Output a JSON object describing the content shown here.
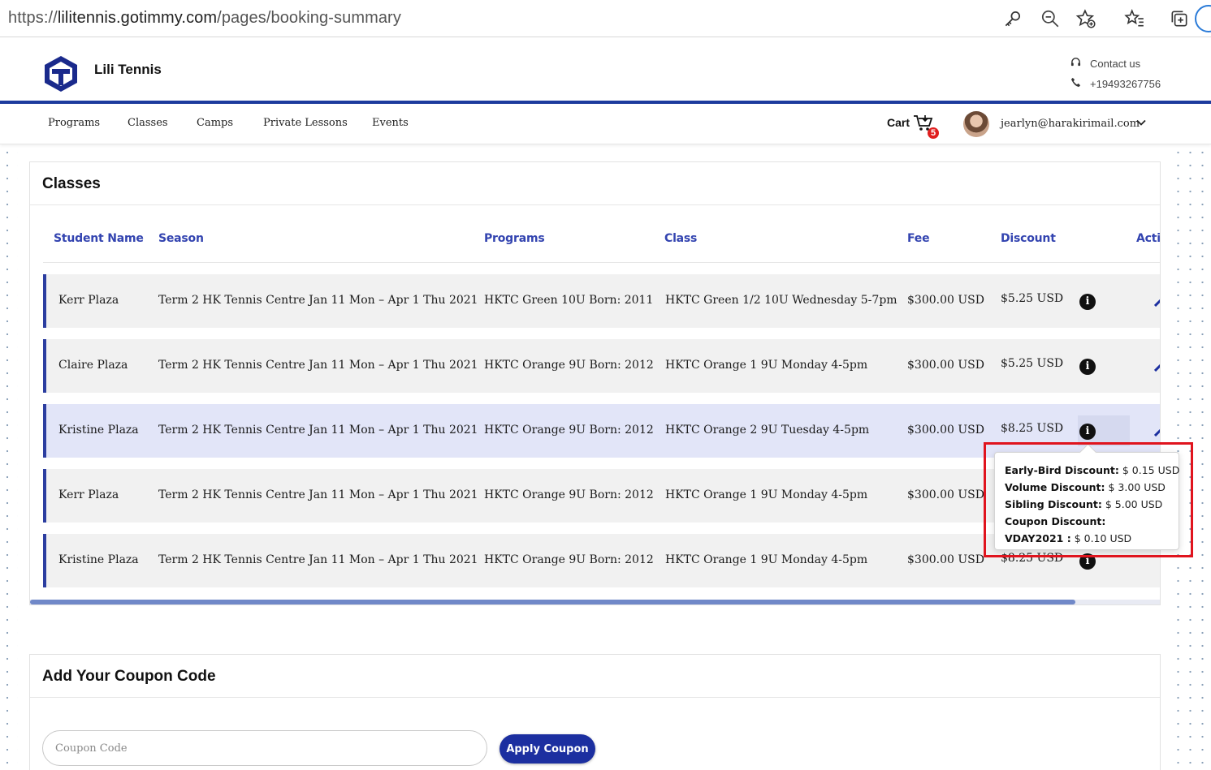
{
  "browser": {
    "url_scheme": "https://",
    "url_host": "lilitennis.gotimmy.com",
    "url_path": "/pages/booking-summary",
    "icons": [
      "key-icon",
      "zoom-out-icon",
      "add-favorite-icon",
      "favorites-icon",
      "collections-icon"
    ]
  },
  "header": {
    "brand": "Lili Tennis",
    "contact_label": "Contact us",
    "phone": "+19493267756"
  },
  "nav": {
    "items": [
      "Programs",
      "Classes",
      "Camps",
      "Private Lessons",
      "Events"
    ],
    "cart_label": "Cart",
    "cart_count": "5",
    "user_email": "jearlyn@harakirimail.com"
  },
  "classes": {
    "title": "Classes",
    "columns": [
      "Student Name",
      "Season",
      "Programs",
      "Class",
      "Fee",
      "Discount",
      "Actio"
    ],
    "rows": [
      {
        "student": "Kerr Plaza",
        "season": "Term 2 HK Tennis Centre Jan 11 Mon – Apr 1 Thu 2021",
        "program": "HKTC Green 10U Born: 2011",
        "class": "HKTC Green 1/2 10U Wednesday 5-7pm",
        "fee": "$300.00 USD",
        "discount": "$5.25 USD"
      },
      {
        "student": "Claire Plaza",
        "season": "Term 2 HK Tennis Centre Jan 11 Mon – Apr 1 Thu 2021",
        "program": "HKTC Orange 9U Born: 2012",
        "class": "HKTC Orange 1 9U Monday 4-5pm",
        "fee": "$300.00 USD",
        "discount": "$5.25 USD"
      },
      {
        "student": "Kristine Plaza",
        "season": "Term 2 HK Tennis Centre Jan 11 Mon – Apr 1 Thu 2021",
        "program": "HKTC Orange 9U Born: 2012",
        "class": "HKTC Orange 2 9U Tuesday 4-5pm",
        "fee": "$300.00 USD",
        "discount": "$8.25 USD"
      },
      {
        "student": "Kerr Plaza",
        "season": "Term 2 HK Tennis Centre Jan 11 Mon – Apr 1 Thu 2021",
        "program": "HKTC Orange 9U Born: 2012",
        "class": "HKTC Orange 1 9U Monday 4-5pm",
        "fee": "$300.00 USD",
        "discount": ""
      },
      {
        "student": "Kristine Plaza",
        "season": "Term 2 HK Tennis Centre Jan 11 Mon – Apr 1 Thu 2021",
        "program": "HKTC Orange 9U Born: 2012",
        "class": "HKTC Orange 1 9U Monday 4-5pm",
        "fee": "$300.00 USD",
        "discount": "$8.25 USD"
      }
    ],
    "info_glyph": "i"
  },
  "tooltip": {
    "lines": [
      {
        "label": "Early-Bird Discount:",
        "value": " $ 0.15 USD"
      },
      {
        "label": "Volume Discount:",
        "value": " $ 3.00 USD"
      },
      {
        "label": "Sibling Discount:",
        "value": " $ 5.00 USD"
      },
      {
        "label": "Coupon Discount:",
        "value": ""
      },
      {
        "label": "VDAY2021 :",
        "value": " $ 0.10 USD"
      }
    ]
  },
  "coupon": {
    "title": "Add Your Coupon Code",
    "placeholder": "Coupon Code",
    "apply_label": "Apply Coupon"
  },
  "colors": {
    "accent": "#1c2fa0",
    "header_text": "#3344b0",
    "row_bar": "#2c3ea0",
    "highlight_row": "#e2e5f8",
    "badge": "#e01e1e",
    "annotation": "#e0141e"
  }
}
